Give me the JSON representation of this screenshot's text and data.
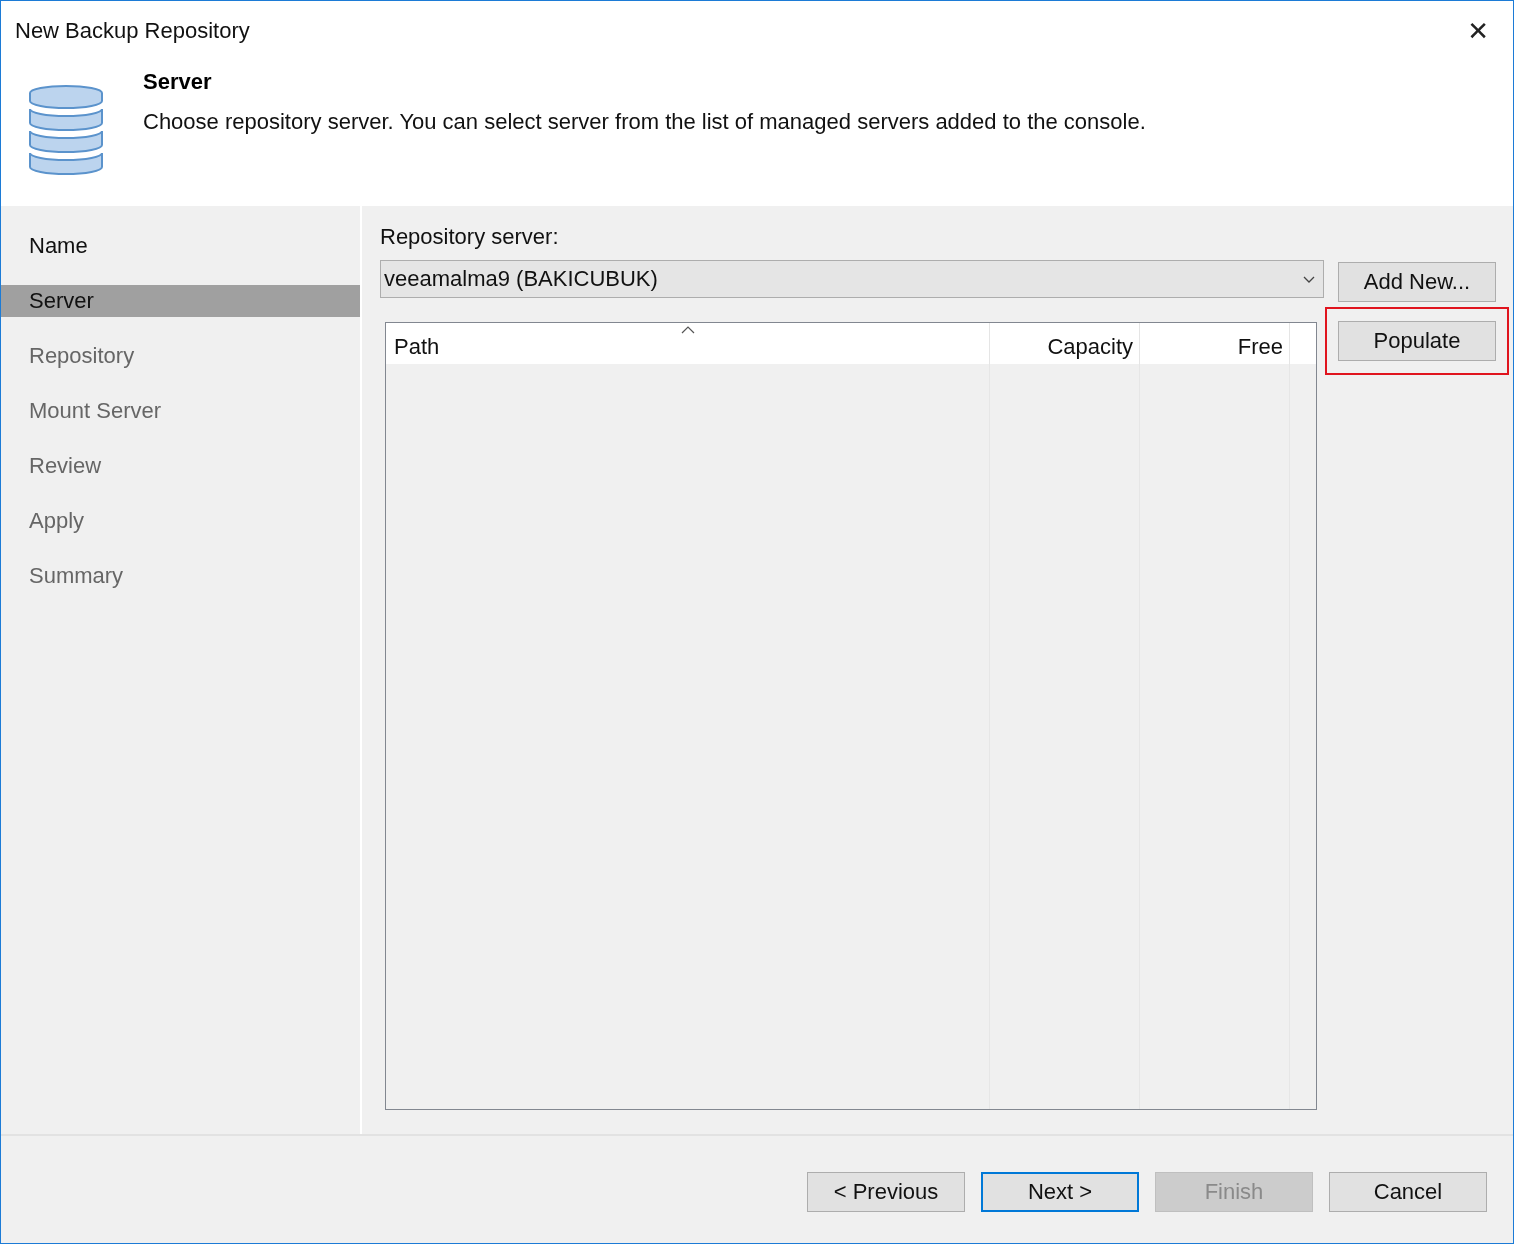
{
  "window": {
    "title": "New Backup Repository",
    "close": "✕"
  },
  "header": {
    "title": "Server",
    "description": "Choose repository server. You can select server from the list of managed servers added to the console."
  },
  "steps": [
    {
      "label": "Name",
      "selected": false,
      "disabled": false
    },
    {
      "label": "Server",
      "selected": true,
      "disabled": false
    },
    {
      "label": "Repository",
      "selected": false,
      "disabled": true
    },
    {
      "label": "Mount Server",
      "selected": false,
      "disabled": true
    },
    {
      "label": "Review",
      "selected": false,
      "disabled": true
    },
    {
      "label": "Apply",
      "selected": false,
      "disabled": true
    },
    {
      "label": "Summary",
      "selected": false,
      "disabled": true
    }
  ],
  "server": {
    "label": "Repository server:",
    "value": "veeamalma9 (BAKICUBUK)"
  },
  "side_buttons": [
    {
      "label": "Add New...",
      "highlighted": false
    },
    {
      "label": "Populate",
      "highlighted": true
    }
  ],
  "table": {
    "columns": [
      {
        "label": "Path",
        "sorted": true
      },
      {
        "label": "Capacity",
        "sorted": false
      },
      {
        "label": "Free",
        "sorted": false
      }
    ]
  },
  "footer_buttons": [
    {
      "label": "< Previous",
      "disabled": false,
      "default": false
    },
    {
      "label": "Next >",
      "disabled": false,
      "default": true
    },
    {
      "label": "Finish",
      "disabled": true,
      "default": false
    },
    {
      "label": "Cancel",
      "disabled": false,
      "default": false
    }
  ]
}
